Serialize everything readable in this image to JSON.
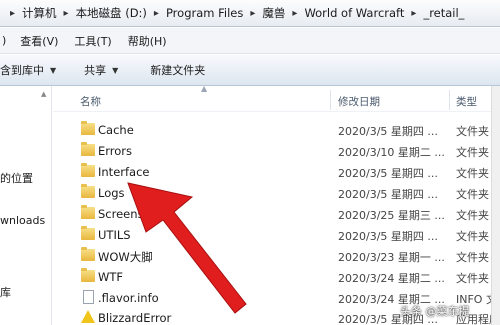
{
  "address_bar": {
    "crumbs": [
      "计算机",
      "本地磁盘 (D:)",
      "Program Files",
      "魔兽",
      "World of Warcraft",
      "_retail_"
    ]
  },
  "menu": {
    "items": [
      "查看(V)",
      "工具(T)",
      "帮助(H)"
    ],
    "first_partial": ")"
  },
  "toolbar": {
    "include_label": "含到库中",
    "share_label": "共享",
    "new_folder_label": "新建文件夹"
  },
  "nav": {
    "items": [
      "的位置",
      "wnloads",
      "库"
    ]
  },
  "columns": {
    "name": "名称",
    "date": "修改日期",
    "type": "类型"
  },
  "rows": [
    {
      "name": "Cache",
      "date": "2020/3/5 星期四 ...",
      "type": "文件夹",
      "icon": "folder-icon"
    },
    {
      "name": "Errors",
      "date": "2020/3/10 星期二 ...",
      "type": "文件夹",
      "icon": "folder-icon"
    },
    {
      "name": "Interface",
      "date": "2020/3/5 星期四 ...",
      "type": "文件夹",
      "icon": "folder-icon"
    },
    {
      "name": "Logs",
      "date": "2020/3/5 星期四 ...",
      "type": "文件夹",
      "icon": "folder-icon"
    },
    {
      "name": "Screensho",
      "date": "2020/3/25 星期三 ...",
      "type": "文件夹",
      "icon": "folder-icon"
    },
    {
      "name": "UTILS",
      "date": "2020/3/5 星期四 ...",
      "type": "文件夹",
      "icon": "folder-icon"
    },
    {
      "name": "WOW大脚",
      "date": "2020/3/23 星期一 ...",
      "type": "文件夹",
      "icon": "folder-icon"
    },
    {
      "name": "WTF",
      "date": "2020/3/24 星期二 ...",
      "type": "文件夹",
      "icon": "folder-icon"
    },
    {
      "name": ".flavor.info",
      "date": "2020/3/24 星期二 ...",
      "type": "INFO 文件",
      "icon": "file-icon"
    },
    {
      "name": "BlizzardError",
      "date": "2020/3/5 星期四 ...",
      "type": "应用程序",
      "icon": "warning-icon"
    }
  ],
  "watermark": "头条 @菜东提",
  "colors": {
    "arrow": "#e01e1e",
    "folder": "#e8b73e"
  }
}
